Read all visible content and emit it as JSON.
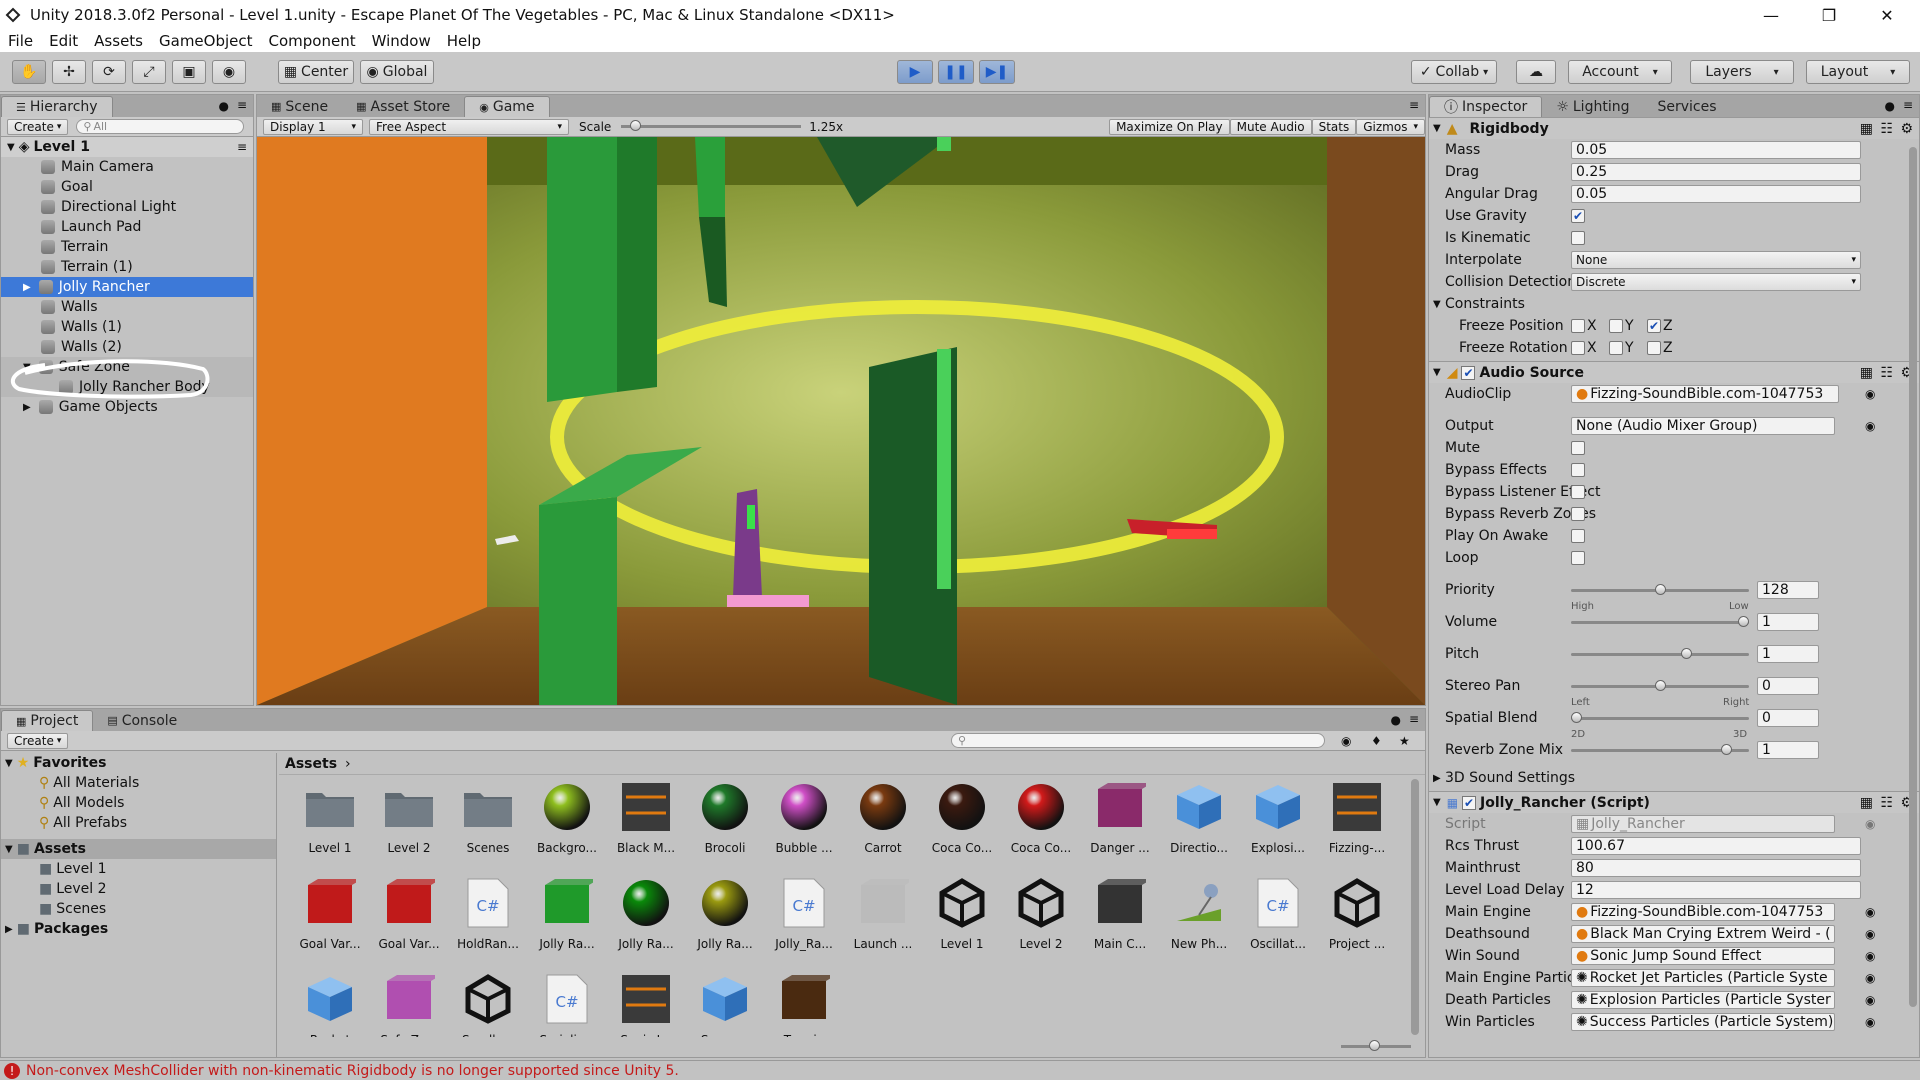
{
  "window": {
    "title": "Unity 2018.3.0f2 Personal - Level 1.unity - Escape Planet Of The Vegetables - PC, Mac & Linux Standalone <DX11>",
    "controls": [
      "minimize",
      "maximize",
      "close"
    ]
  },
  "menu": [
    "File",
    "Edit",
    "Assets",
    "GameObject",
    "Component",
    "Window",
    "Help"
  ],
  "toolbar": {
    "center_label": "Center",
    "global_label": "Global",
    "collab_label": "Collab",
    "account_label": "Account",
    "layers_label": "Layers",
    "layout_label": "Layout"
  },
  "hierarchy": {
    "tab": "Hierarchy",
    "create": "Create",
    "search_placeholder": "All",
    "scene": "Level 1",
    "items": [
      {
        "label": "Main Camera"
      },
      {
        "label": "Goal"
      },
      {
        "label": "Directional Light"
      },
      {
        "label": "Launch Pad"
      },
      {
        "label": "Terrain"
      },
      {
        "label": "Terrain (1)"
      },
      {
        "label": "Jolly Rancher"
      },
      {
        "label": "Walls"
      },
      {
        "label": "Walls (1)"
      },
      {
        "label": "Walls (2)"
      },
      {
        "label": "Safe Zone"
      },
      {
        "label": "Jolly Rancher Body"
      },
      {
        "label": "Game Objects"
      }
    ]
  },
  "viewtabs": {
    "scene": "Scene",
    "asset_store": "Asset Store",
    "game": "Game",
    "display": "Display 1",
    "aspect": "Free Aspect",
    "scale_label": "Scale",
    "scale_value": "1.25x",
    "scale_level": 0.05,
    "maximize": "Maximize On Play",
    "mute": "Mute Audio",
    "stats": "Stats",
    "gizmos": "Gizmos"
  },
  "inspector": {
    "tabs": [
      "Inspector",
      "Lighting",
      "Services"
    ],
    "rigidbody": {
      "title": "Rigidbody",
      "mass_label": "Mass",
      "mass": "0.05",
      "drag_label": "Drag",
      "drag": "0.25",
      "angular_label": "Angular Drag",
      "angular": "0.05",
      "gravity_label": "Use Gravity",
      "kinematic_label": "Is Kinematic",
      "interpolate_label": "Interpolate",
      "interpolate": "None",
      "collision_label": "Collision Detection",
      "collision": "Discrete",
      "constraints_label": "Constraints",
      "freeze_pos_label": "Freeze Position",
      "freeze_rot_label": "Freeze Rotation",
      "x": "X",
      "y": "Y",
      "z": "Z"
    },
    "audio": {
      "title": "Audio Source",
      "clip_label": "AudioClip",
      "clip": "Fizzing-SoundBible.com-1047753",
      "output_label": "Output",
      "output": "None (Audio Mixer Group)",
      "mute_label": "Mute",
      "bypass_effects_label": "Bypass Effects",
      "bypass_listener_label": "Bypass Listener Effect",
      "bypass_reverb_label": "Bypass Reverb Zones",
      "play_awake_label": "Play On Awake",
      "loop_label": "Loop",
      "priority_label": "Priority",
      "priority": "128",
      "priority_level": 0.5,
      "high": "High",
      "low": "Low",
      "volume_label": "Volume",
      "volume": "1",
      "volume_level": 1,
      "pitch_label": "Pitch",
      "pitch": "1",
      "pitch_level": 0.66,
      "stereo_label": "Stereo Pan",
      "stereo": "0",
      "stereo_level": 0.5,
      "left": "Left",
      "right": "Right",
      "spatial_label": "Spatial Blend",
      "spatial": "0",
      "spatial_level": 0,
      "two_d": "2D",
      "three_d": "3D",
      "reverb_label": "Reverb Zone Mix",
      "reverb": "1",
      "reverb_level": 0.9,
      "sound3d_label": "3D Sound Settings"
    },
    "script": {
      "title": "Jolly_Rancher (Script)",
      "script_label": "Script",
      "script": "Jolly_Rancher",
      "rcs_label": "Rcs Thrust",
      "rcs": "100.67",
      "main_label": "Mainthrust",
      "main": "80",
      "delay_label": "Level Load Delay",
      "delay": "12",
      "engine_label": "Main Engine",
      "engine": "Fizzing-SoundBible.com-1047753",
      "death_label": "Deathsound",
      "death": "Black Man Crying Extrem Weird - (",
      "win_label": "Win Sound",
      "win": "Sonic Jump Sound Effect",
      "mep_label": "Main Engine Particles",
      "mep": "Rocket Jet Particles (Particle Syste",
      "dp_label": "Death Particles",
      "dp": "Explosion Particles (Particle Syster",
      "wp_label": "Win Particles",
      "wp": "Success Particles (Particle System)"
    }
  },
  "project": {
    "tab_project": "Project",
    "tab_console": "Console",
    "create": "Create",
    "favorites": "Favorites",
    "fav_items": [
      "All Materials",
      "All Models",
      "All Prefabs"
    ],
    "assets_root": "Assets",
    "asset_folders": [
      "Level 1",
      "Level 2",
      "Scenes"
    ],
    "packages": "Packages",
    "breadcrumb": "Assets",
    "assets": [
      {
        "name": "Level 1",
        "icon": "folder-icon",
        "color": "#606a72"
      },
      {
        "name": "Level 2",
        "icon": "folder-icon",
        "color": "#606a72"
      },
      {
        "name": "Scenes",
        "icon": "folder-icon",
        "color": "#606a72"
      },
      {
        "name": "Backgro...",
        "icon": "sphere-icon",
        "color": "#8fbf1f"
      },
      {
        "name": "Black M...",
        "icon": "audio-icon",
        "color": "#e07a10"
      },
      {
        "name": "Brocoli",
        "icon": "sphere-icon",
        "color": "#1f7a2a"
      },
      {
        "name": "Bubble ...",
        "icon": "sphere-icon",
        "color": "#d04fc7"
      },
      {
        "name": "Carrot",
        "icon": "sphere-icon",
        "color": "#7a3a10"
      },
      {
        "name": "Coca Co...",
        "icon": "sphere-icon",
        "color": "#3b1a10"
      },
      {
        "name": "Coca Co...",
        "icon": "sphere-icon",
        "color": "#d21a1a"
      },
      {
        "name": "Danger ...",
        "icon": "prefab-icon",
        "color": "#8a2a6a"
      },
      {
        "name": "Directio...",
        "icon": "cube-icon",
        "color": "#4a90d9"
      },
      {
        "name": "Explosi...",
        "icon": "cube-icon",
        "color": "#4a90d9"
      },
      {
        "name": "Fizzing-...",
        "icon": "audio-icon",
        "color": "#e07a10"
      },
      {
        "name": "Goal Var...",
        "icon": "prefab-icon",
        "color": "#c01a1a"
      },
      {
        "name": "Goal Var...",
        "icon": "prefab-icon",
        "color": "#c01a1a"
      },
      {
        "name": "HoldRan...",
        "icon": "script-icon",
        "color": "#4a7ad0"
      },
      {
        "name": "Jolly Ra...",
        "icon": "prefab-icon",
        "color": "#1f9a2a"
      },
      {
        "name": "Jolly Ra...",
        "icon": "sphere-icon",
        "color": "#0a8a0a"
      },
      {
        "name": "Jolly Ra...",
        "icon": "sphere-icon",
        "color": "#9a9a10"
      },
      {
        "name": "Jolly_Ra...",
        "icon": "script-icon",
        "color": "#4a7ad0"
      },
      {
        "name": "Launch ...",
        "icon": "prefab-icon",
        "color": "#bbbbbb"
      },
      {
        "name": "Level 1",
        "icon": "unity-icon",
        "color": "#111111"
      },
      {
        "name": "Level 2",
        "icon": "unity-icon",
        "color": "#111111"
      },
      {
        "name": "Main C...",
        "icon": "prefab-icon",
        "color": "#333333"
      },
      {
        "name": "New Ph...",
        "icon": "physics-icon",
        "color": "#6aa02a"
      },
      {
        "name": "Oscillat...",
        "icon": "script-icon",
        "color": "#4a7ad0"
      },
      {
        "name": "Project ...",
        "icon": "unity-icon",
        "color": "#111111"
      },
      {
        "name": "Rocket",
        "icon": "cube-icon",
        "color": "#4a90d9"
      },
      {
        "name": "Safe Zo...",
        "icon": "prefab-icon",
        "color": "#b04fb0"
      },
      {
        "name": "Sandbox",
        "icon": "unity-icon",
        "color": "#111111"
      },
      {
        "name": "Serializ...",
        "icon": "script-icon",
        "color": "#4a7ad0"
      },
      {
        "name": "Sonic J...",
        "icon": "audio-icon",
        "color": "#e07a10"
      },
      {
        "name": "Success",
        "icon": "cube-icon",
        "color": "#4a90d9"
      },
      {
        "name": "Terrain",
        "icon": "prefab-icon",
        "color": "#4a2a10"
      }
    ]
  },
  "status": {
    "message": "Non-convex MeshCollider with non-kinematic Rigidbody is no longer supported since Unity 5."
  }
}
